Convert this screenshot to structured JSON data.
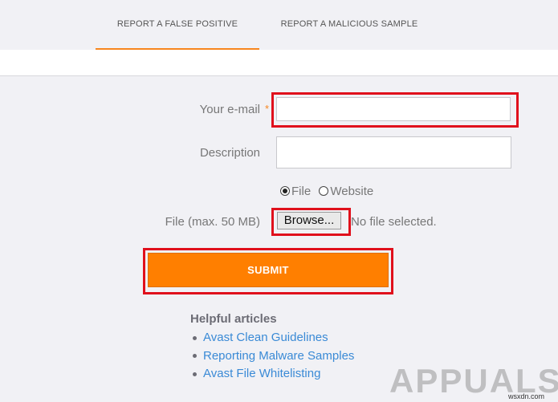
{
  "tabs": [
    {
      "label": "REPORT A FALSE POSITIVE"
    },
    {
      "label": "REPORT A MALICIOUS SAMPLE"
    }
  ],
  "form": {
    "email_label": "Your e-mail",
    "required_mark": "*",
    "email_value": "",
    "description_label": "Description",
    "description_value": "",
    "type_options": [
      {
        "label": "File",
        "selected": true
      },
      {
        "label": "Website",
        "selected": false
      }
    ],
    "file_label": "File (max. 50 MB)",
    "browse_label": "Browse...",
    "no_file_text": "No file selected.",
    "submit_label": "SUBMIT"
  },
  "helpful": {
    "heading": "Helpful articles",
    "articles": [
      "Avast Clean Guidelines",
      "Reporting Malware Samples",
      "Avast File Whitelisting"
    ]
  },
  "watermark": "APPUALS",
  "credit": "wsxdn.com",
  "colors": {
    "accent": "#f7861e",
    "submit": "#ff7f00",
    "highlight": "#e0101c",
    "link": "#3a8ad6",
    "background": "#f1f1f5"
  },
  "icons": {
    "bullet": "bullet-icon",
    "resize": "resize-grip-icon"
  }
}
